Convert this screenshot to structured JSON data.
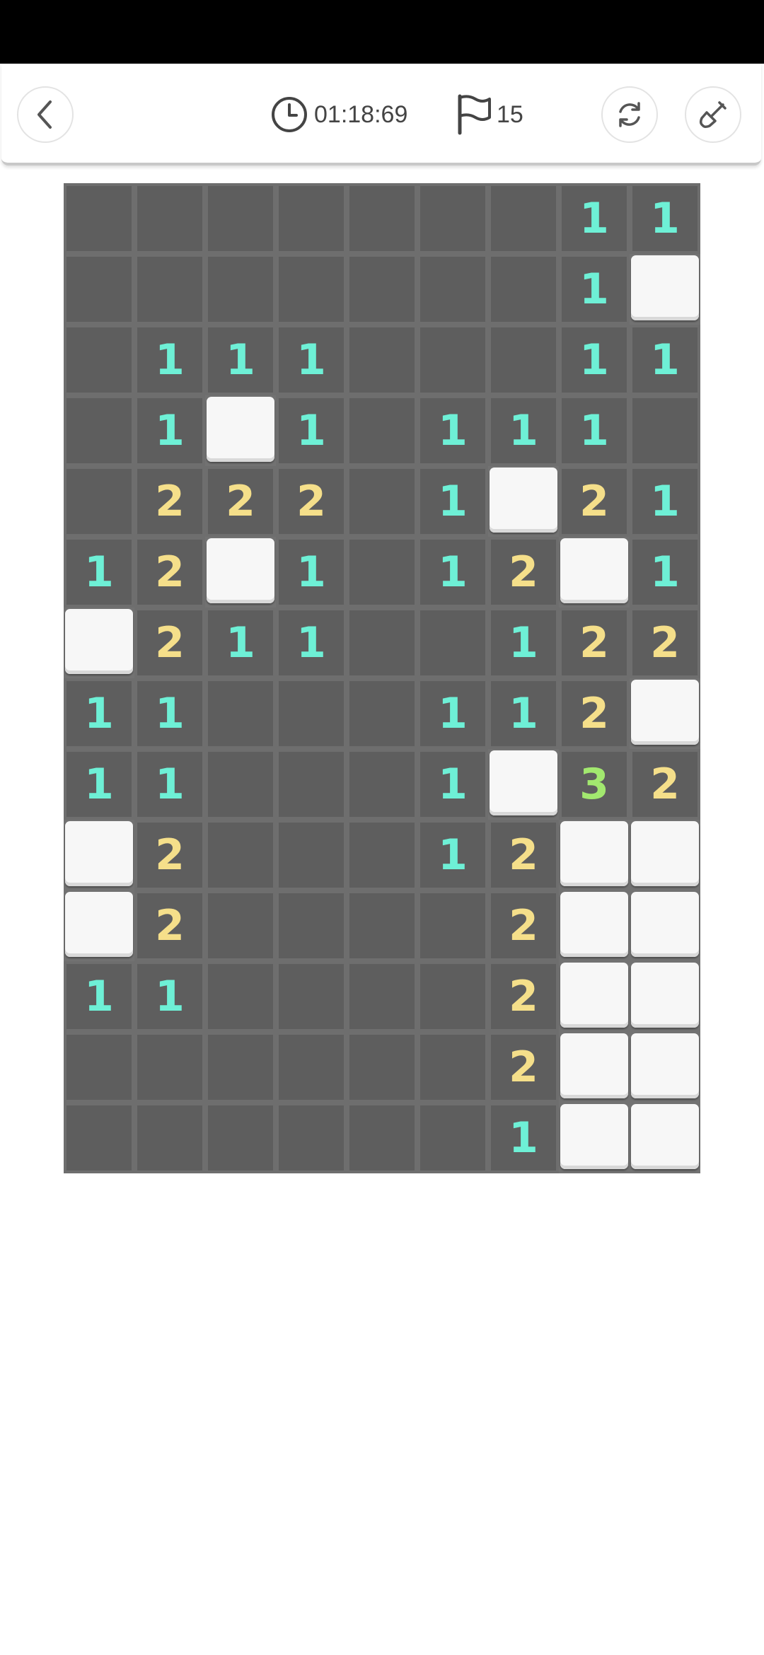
{
  "header": {
    "timer": "01:18:69",
    "flag_count": "15",
    "back_icon": "chevron-left-icon",
    "clock_icon": "clock-icon",
    "flag_icon": "flag-icon",
    "restart_icon": "refresh-icon",
    "tool_icon": "shovel-icon"
  },
  "colors": {
    "status_bar": "#000000",
    "board_background": "#727272",
    "hidden_tile": "#5e5e5e",
    "revealed_tile": "#f7f7f7",
    "number_1": "#6ef0d6",
    "number_2": "#f5df8a",
    "number_3": "#a2e86f"
  },
  "board": {
    "legend": "H = hidden tile with no number, R = raised/revealed white tile, digit = hidden tile showing that number",
    "rows": [
      [
        "H",
        "H",
        "H",
        "H",
        "H",
        "H",
        "H",
        "1",
        "1"
      ],
      [
        "H",
        "H",
        "H",
        "H",
        "H",
        "H",
        "H",
        "1",
        "R"
      ],
      [
        "H",
        "1",
        "1",
        "1",
        "H",
        "H",
        "H",
        "1",
        "1"
      ],
      [
        "H",
        "1",
        "R",
        "1",
        "H",
        "1",
        "1",
        "1",
        "H"
      ],
      [
        "H",
        "2",
        "2",
        "2",
        "H",
        "1",
        "R",
        "2",
        "1"
      ],
      [
        "1",
        "2",
        "R",
        "1",
        "H",
        "1",
        "2",
        "R",
        "1"
      ],
      [
        "R",
        "2",
        "1",
        "1",
        "H",
        "H",
        "1",
        "2",
        "2"
      ],
      [
        "1",
        "1",
        "H",
        "H",
        "H",
        "1",
        "1",
        "2",
        "R"
      ],
      [
        "1",
        "1",
        "H",
        "H",
        "H",
        "1",
        "R",
        "3",
        "2"
      ],
      [
        "R",
        "2",
        "H",
        "H",
        "H",
        "1",
        "2",
        "R",
        "R"
      ],
      [
        "R",
        "2",
        "H",
        "H",
        "H",
        "H",
        "2",
        "R",
        "R"
      ],
      [
        "1",
        "1",
        "H",
        "H",
        "H",
        "H",
        "2",
        "R",
        "R"
      ],
      [
        "H",
        "H",
        "H",
        "H",
        "H",
        "H",
        "2",
        "R",
        "R"
      ],
      [
        "H",
        "H",
        "H",
        "H",
        "H",
        "H",
        "1",
        "R",
        "R"
      ]
    ]
  }
}
